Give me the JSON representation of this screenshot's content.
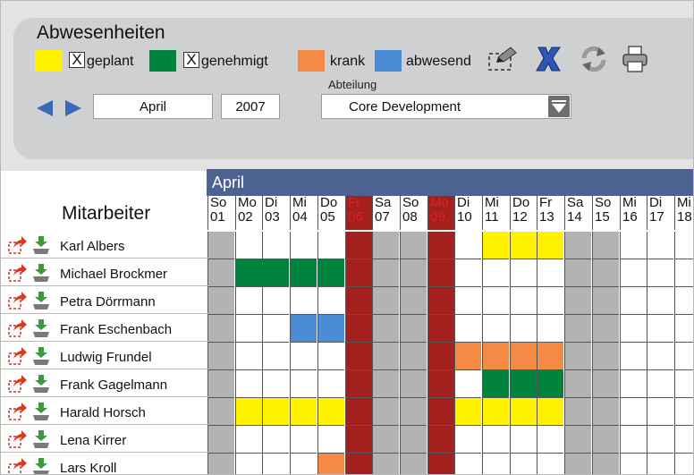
{
  "app": {
    "title": "Abwesenheiten"
  },
  "legend": [
    {
      "key": "geplant",
      "label": "geplant",
      "color": "#fff200",
      "checked": true,
      "check_glyph": "X"
    },
    {
      "key": "genehmigt",
      "label": "genehmigt",
      "color": "#00843d",
      "checked": true,
      "check_glyph": "X"
    },
    {
      "key": "krank",
      "label": "krank",
      "color": "#f58a44",
      "checked": false
    },
    {
      "key": "abwesend",
      "label": "abwesend",
      "color": "#4a8dd6",
      "checked": false
    }
  ],
  "toolbar": {
    "icons": [
      "select-rect-icon",
      "delete-x-icon",
      "refresh-icon",
      "print-icon"
    ]
  },
  "filters": {
    "month": "April",
    "year": "2007",
    "department_label": "Abteilung",
    "department": "Core Development"
  },
  "calendar": {
    "month_label": "April",
    "column_header": "Mitarbeiter",
    "days": [
      {
        "dow": "So",
        "num": "01",
        "type": "weekend"
      },
      {
        "dow": "Mo",
        "num": "02",
        "type": "work"
      },
      {
        "dow": "Di",
        "num": "03",
        "type": "work"
      },
      {
        "dow": "Mi",
        "num": "04",
        "type": "work"
      },
      {
        "dow": "Do",
        "num": "05",
        "type": "work"
      },
      {
        "dow": "Fr",
        "num": "06",
        "type": "holiday"
      },
      {
        "dow": "Sa",
        "num": "07",
        "type": "weekend"
      },
      {
        "dow": "So",
        "num": "08",
        "type": "weekend"
      },
      {
        "dow": "Mo",
        "num": "09",
        "type": "holiday"
      },
      {
        "dow": "Di",
        "num": "10",
        "type": "work"
      },
      {
        "dow": "Mi",
        "num": "11",
        "type": "work"
      },
      {
        "dow": "Do",
        "num": "12",
        "type": "work"
      },
      {
        "dow": "Fr",
        "num": "13",
        "type": "work"
      },
      {
        "dow": "Sa",
        "num": "14",
        "type": "weekend"
      },
      {
        "dow": "So",
        "num": "15",
        "type": "weekend"
      },
      {
        "dow": "Mi",
        "num": "16",
        "type": "work"
      },
      {
        "dow": "Di",
        "num": "17",
        "type": "work"
      },
      {
        "dow": "Mi",
        "num": "18",
        "type": "work"
      }
    ],
    "colors": {
      "weekend": "#b3b3b3",
      "holiday": "#a3201f",
      "holiday_text": "#e02020",
      "work": "#ffffff",
      "geplant": "#fff200",
      "genehmigt": "#00843d",
      "krank": "#f58a44",
      "abwesend": "#4a8dd6"
    },
    "employees": [
      {
        "name": "Karl Albers",
        "absences": [
          {
            "day": "11",
            "status": "geplant"
          },
          {
            "day": "12",
            "status": "geplant"
          },
          {
            "day": "13",
            "status": "geplant"
          }
        ]
      },
      {
        "name": "Michael Brockmer",
        "absences": [
          {
            "day": "02",
            "status": "genehmigt"
          },
          {
            "day": "03",
            "status": "genehmigt"
          },
          {
            "day": "04",
            "status": "genehmigt"
          },
          {
            "day": "05",
            "status": "genehmigt"
          }
        ]
      },
      {
        "name": "Petra Dörrmann",
        "absences": []
      },
      {
        "name": "Frank Eschenbach",
        "absences": [
          {
            "day": "04",
            "status": "abwesend"
          },
          {
            "day": "05",
            "status": "abwesend"
          }
        ]
      },
      {
        "name": "Ludwig Frundel",
        "absences": [
          {
            "day": "10",
            "status": "krank"
          },
          {
            "day": "11",
            "status": "krank"
          },
          {
            "day": "12",
            "status": "krank"
          },
          {
            "day": "13",
            "status": "krank"
          }
        ]
      },
      {
        "name": "Frank Gagelmann",
        "absences": [
          {
            "day": "11",
            "status": "genehmigt"
          },
          {
            "day": "12",
            "status": "genehmigt"
          },
          {
            "day": "13",
            "status": "genehmigt"
          }
        ]
      },
      {
        "name": "Harald Horsch",
        "absences": [
          {
            "day": "02",
            "status": "geplant"
          },
          {
            "day": "03",
            "status": "geplant"
          },
          {
            "day": "04",
            "status": "geplant"
          },
          {
            "day": "05",
            "status": "geplant"
          },
          {
            "day": "10",
            "status": "geplant"
          },
          {
            "day": "11",
            "status": "geplant"
          },
          {
            "day": "12",
            "status": "geplant"
          },
          {
            "day": "13",
            "status": "geplant"
          }
        ]
      },
      {
        "name": "Lena Kirrer",
        "absences": []
      },
      {
        "name": "Lars Kroll",
        "absences": [
          {
            "day": "05",
            "status": "krank"
          }
        ]
      }
    ],
    "row_icons": [
      "edit-arrow-icon",
      "download-tray-icon"
    ]
  }
}
